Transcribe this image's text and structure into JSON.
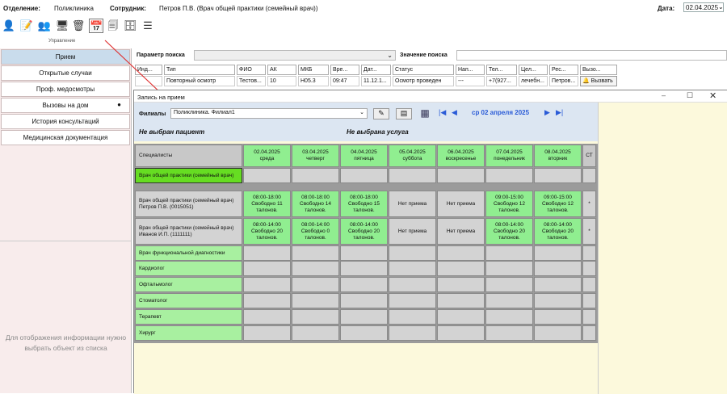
{
  "top": {
    "dept_label": "Отделение:",
    "dept_value": "Поликлиника",
    "emp_label": "Сотрудник:",
    "emp_value": "Петров П.В. (Врач общей практики (семейный врач))",
    "date_label": "Дата:",
    "date_value": "02.04.2025"
  },
  "toolbar": {
    "label": "Управление"
  },
  "nav": {
    "items": [
      "Прием",
      "Открытые случаи",
      "Проф. медосмотры",
      "Вызовы на дом",
      "История консультаций",
      "Медицинская документация"
    ],
    "message": "Для отображения информации нужно выбрать объект из списка"
  },
  "search": {
    "param_label": "Параметр поиска",
    "value_label": "Значение поиска"
  },
  "table": {
    "headers": [
      "Инд...",
      "Тип",
      "ФИО",
      "АК",
      "МКБ",
      "Вре...",
      "Дат...",
      "Статус",
      "Нап...",
      "Тел...",
      "Цел...",
      "Рес...",
      "Вызо..."
    ],
    "row": [
      "",
      "Повторный осмотр",
      "Тестов...",
      "10",
      "H05.3",
      "09:47",
      "11.12.1...",
      "Осмотр проведен",
      "---",
      "+7(927...",
      "лечебн...",
      "Петров...",
      "Вызвать"
    ]
  },
  "dialog": {
    "title": "Запись на прием",
    "branch_label": "Филиалы",
    "branch_value": "Поликлиника. Филиал1",
    "current_date": "ср 02 апреля 2025",
    "no_patient": "Не выбран пациент",
    "no_service": "Не выбрана услуга",
    "specialists_header": "Специалисты",
    "last_col": "СТ",
    "days": [
      {
        "date": "02.04.2025",
        "dow": "среда"
      },
      {
        "date": "03.04.2025",
        "dow": "четверг"
      },
      {
        "date": "04.04.2025",
        "dow": "пятница"
      },
      {
        "date": "05.04.2025",
        "dow": "суббота"
      },
      {
        "date": "06.04.2025",
        "dow": "воскресенье"
      },
      {
        "date": "07.04.2025",
        "dow": "понедельник"
      },
      {
        "date": "08.04.2025",
        "dow": "вторник"
      }
    ],
    "rows": [
      {
        "name": "Врач общей практики (семейный врач)",
        "kind": "group-selected",
        "cells": [
          "",
          "",
          "",
          "",
          "",
          "",
          ""
        ],
        "last": ""
      },
      {
        "name": "Врач общей практики (семейный врач) Петров П.В. (0015051)",
        "kind": "doctor",
        "cells": [
          "08:00-18:00 Свободно 11 талонов.",
          "08:00-18:00 Свободно 14 талонов.",
          "08:00-18:00 Свободно 15 талонов.",
          "Нет приема",
          "Нет приема",
          "09:00-15:00 Свободно 12 талонов.",
          "09:00-15:00 Свободно 12 талонов."
        ],
        "last": "*"
      },
      {
        "name": "Врач общей практики (семейный врач) Иванов И.П. (1111111)",
        "kind": "doctor",
        "cells": [
          "08:00-14:00 Свободно 20 талонов.",
          "08:00-14:00 Свободно 0 талонов.",
          "08:00-14:00 Свободно 20 талонов.",
          "Нет приема",
          "Нет приема",
          "08:00-14:00 Свободно 20 талонов.",
          "08:00-14:00 Свободно 20 талонов."
        ],
        "last": "*"
      },
      {
        "name": "Врач функциональной диагностики",
        "kind": "group",
        "cells": [
          "",
          "",
          "",
          "",
          "",
          "",
          ""
        ],
        "last": ""
      },
      {
        "name": "Кардиолог",
        "kind": "group",
        "cells": [
          "",
          "",
          "",
          "",
          "",
          "",
          ""
        ],
        "last": ""
      },
      {
        "name": "Офтальмолог",
        "kind": "group",
        "cells": [
          "",
          "",
          "",
          "",
          "",
          "",
          ""
        ],
        "last": ""
      },
      {
        "name": "Стоматолог",
        "kind": "group",
        "cells": [
          "",
          "",
          "",
          "",
          "",
          "",
          ""
        ],
        "last": ""
      },
      {
        "name": "Терапевт",
        "kind": "group",
        "cells": [
          "",
          "",
          "",
          "",
          "",
          "",
          ""
        ],
        "last": ""
      },
      {
        "name": "Хирург",
        "kind": "group",
        "cells": [
          "",
          "",
          "",
          "",
          "",
          "",
          ""
        ],
        "last": ""
      }
    ]
  }
}
